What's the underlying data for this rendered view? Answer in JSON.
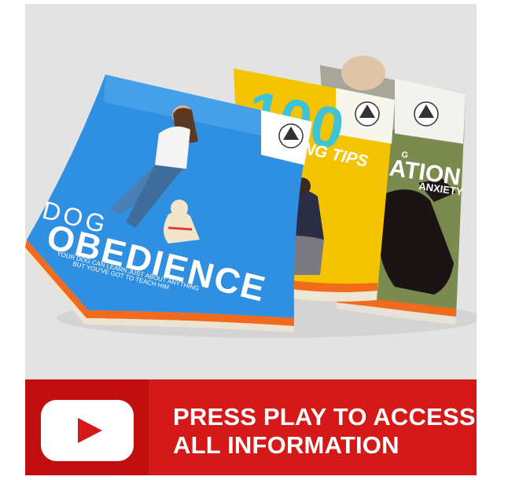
{
  "books": {
    "book1": {
      "title_line1": "DOG",
      "title_line2": "OBEDIENCE",
      "subtitle_line1": "YOUR DOG CAN LEARN JUST ABOUT ANYTHING",
      "subtitle_line2": "BUT YOU'VE GOT TO TEACH HIM"
    },
    "book2": {
      "title_number": "100",
      "title_text": "NG TIPS"
    },
    "book3": {
      "title_small": "G",
      "title_main": "ATION",
      "title_sub": "ANXIETY"
    }
  },
  "cta": {
    "line1": "PRESS PLAY TO ACCESS",
    "line2": "ALL INFORMATION",
    "icon": "play-icon"
  },
  "colors": {
    "cta_red": "#d51818",
    "cta_dark_red": "#c10f0f",
    "book1_blue": "#2f8fe0",
    "book2_yellow": "#f5c400",
    "book_orange": "#f26a1b"
  }
}
